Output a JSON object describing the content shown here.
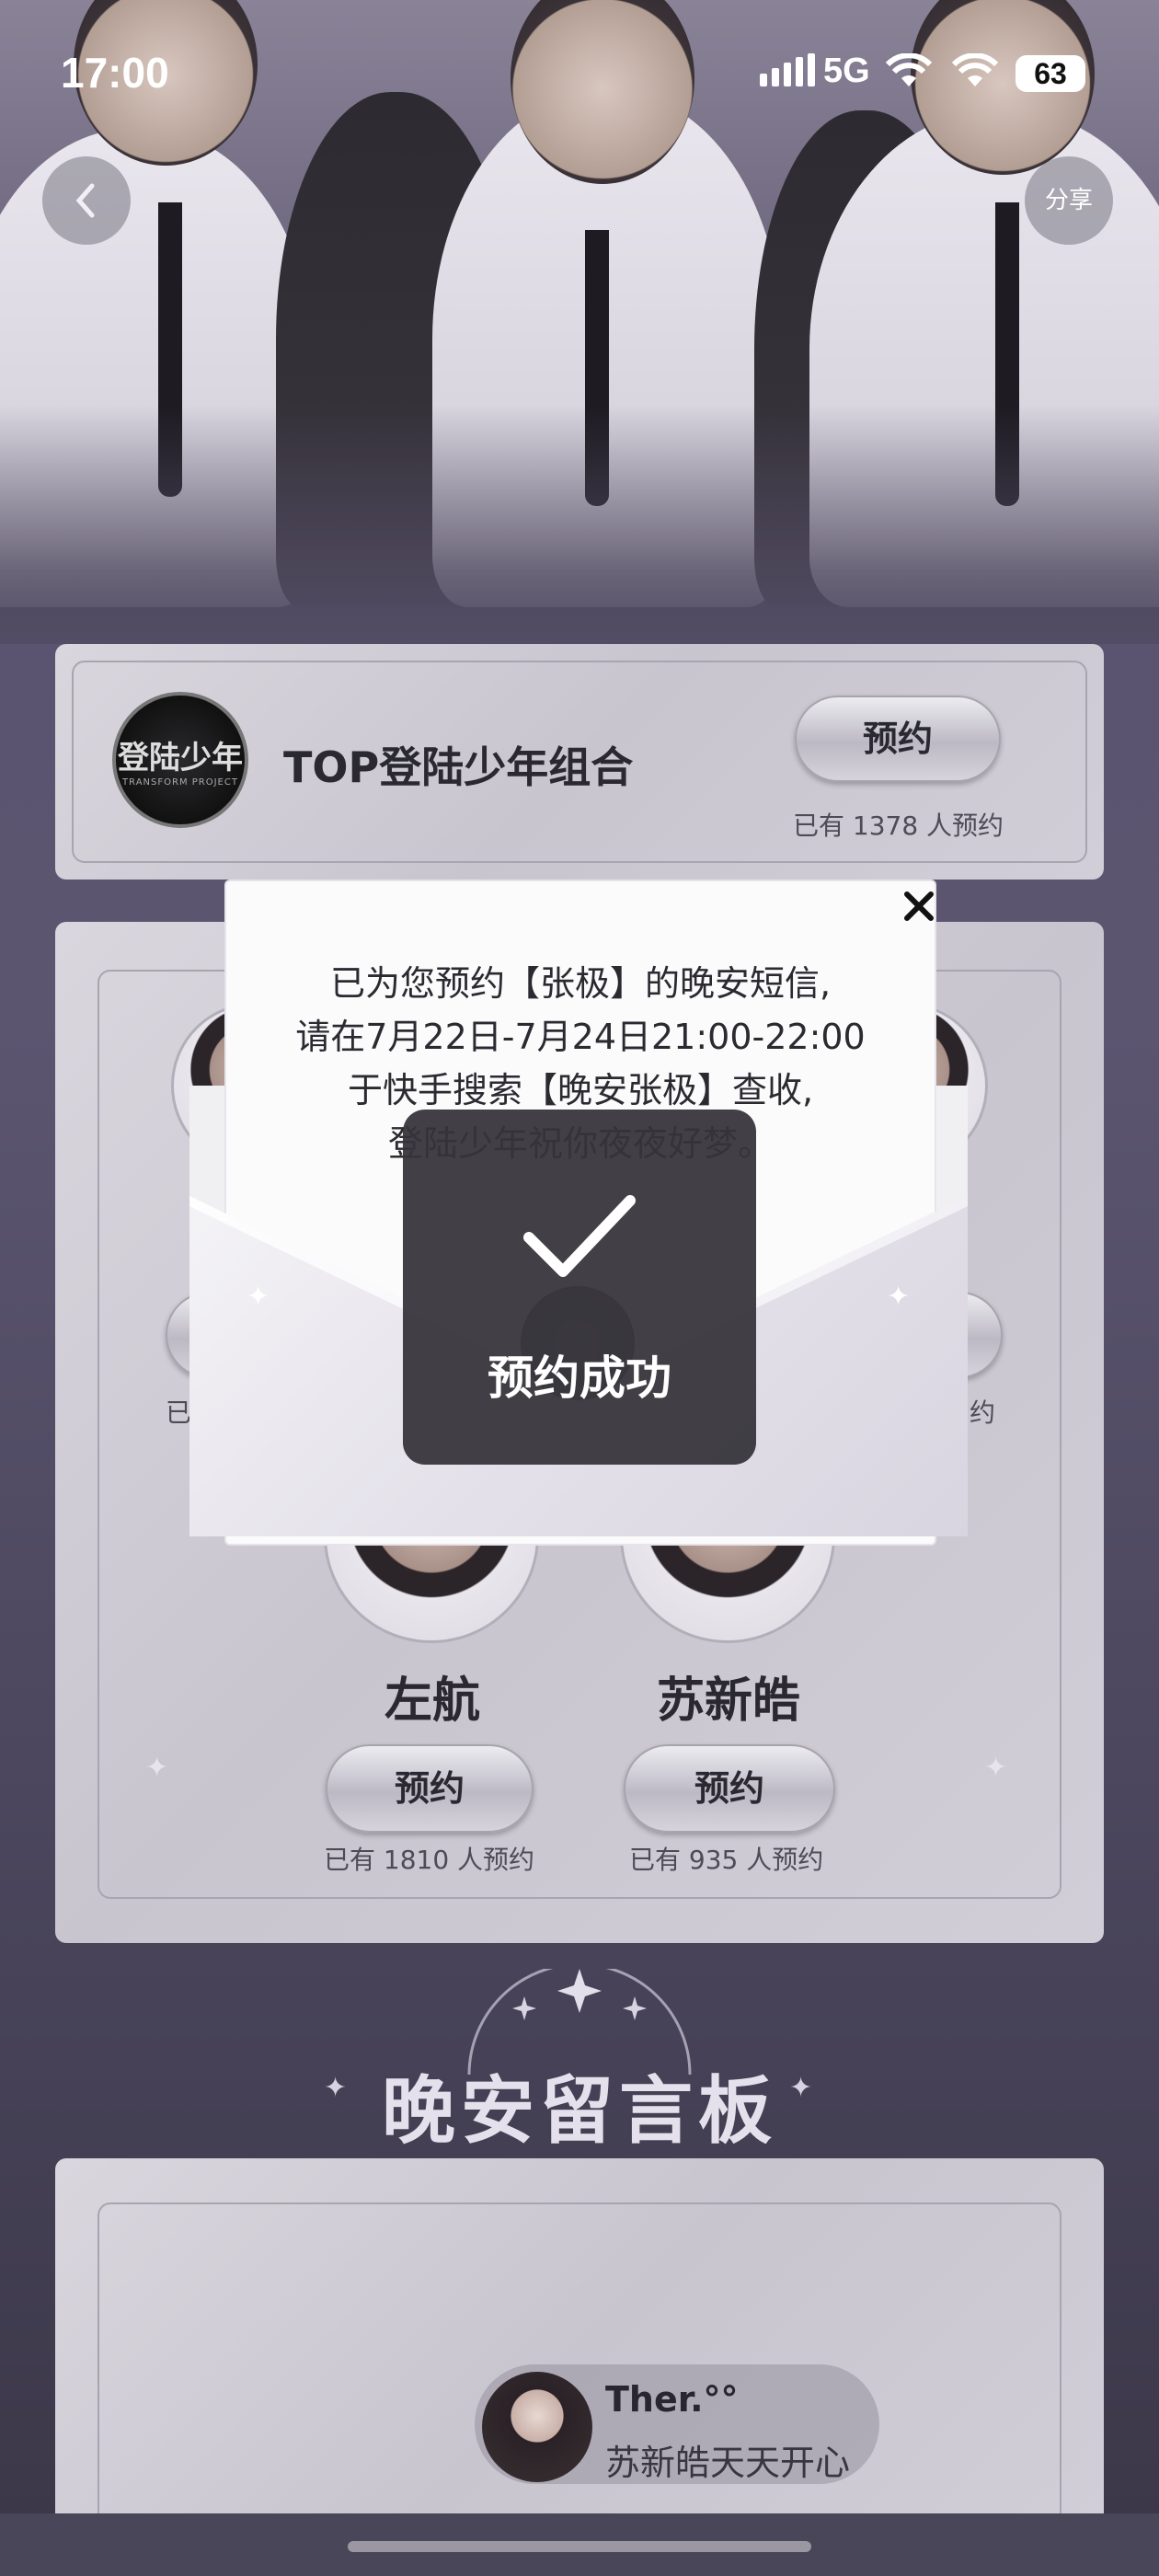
{
  "status_bar": {
    "time": "17:00",
    "network": "5G",
    "battery": "63"
  },
  "header": {
    "back_icon": "chevron-left-icon",
    "share_label": "分享"
  },
  "group_card": {
    "logo_text": "登陆少年",
    "logo_subtext": "TRANSFORM PROJECT",
    "name": "TOP登陆少年组合",
    "reserve_label": "预约",
    "count_text": "已有 1378 人预约"
  },
  "members": [
    {
      "name": "左航",
      "reserve_label": "预约",
      "count_text": "已有 1810 人预约"
    },
    {
      "name": "苏新皓",
      "reserve_label": "预约",
      "count_text": "已有 935 人预约"
    }
  ],
  "partial_counts": {
    "left": "已",
    "right": "约"
  },
  "message_board": {
    "title": "晚安留言板",
    "message": {
      "user": "Ther.°°",
      "text": "苏新皓天天开心"
    }
  },
  "modal": {
    "lines": [
      "已为您预约【张极】的晚安短信,",
      "请在7月22日-7月24日21:00-22:00",
      "于快手搜索【晚安张极】查收,",
      "登陆少年祝你夜夜好梦。"
    ],
    "close_icon": "close-icon"
  },
  "toast": {
    "icon": "checkmark-icon",
    "text": "预约成功"
  },
  "colors": {
    "background": "#4a4560",
    "card": "#d2ced8",
    "toast": "#36343a"
  }
}
